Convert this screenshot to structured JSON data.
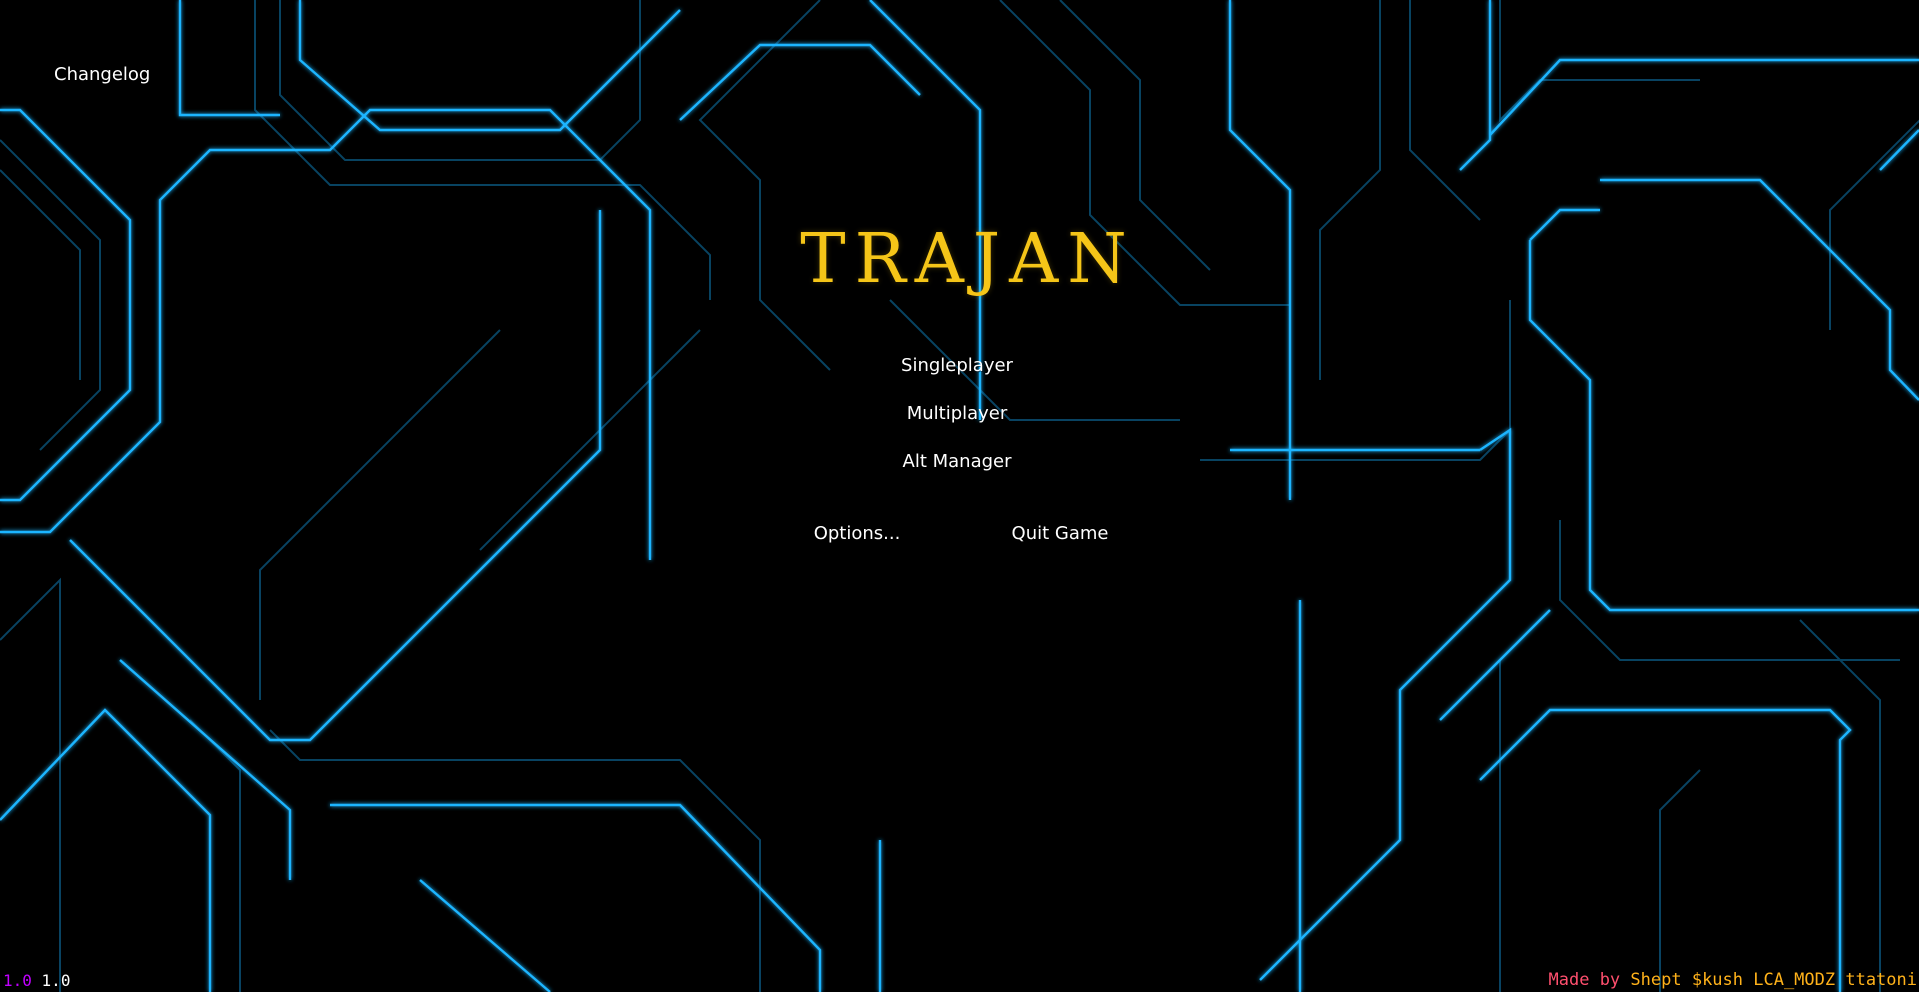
{
  "title": {
    "text": "TRAJAN",
    "color": "#f5c518"
  },
  "changelog": {
    "label": "Changelog"
  },
  "menu": {
    "singleplayer_label": "Singleplayer",
    "multiplayer_label": "Multiplayer",
    "alt_manager_label": "Alt Manager",
    "options_label": "Options...",
    "quit_label": "Quit Game"
  },
  "version": {
    "first": "1.0",
    "second": "1.0",
    "first_color": "#c000ff",
    "second_color": "#ffffff"
  },
  "credits": {
    "prefix": "Made by",
    "names": "Shept $kush LCA_MODZ ttatoni",
    "prefix_color": "#ff4f6e",
    "names_color": "#ffb21a"
  },
  "background": {
    "line_color": "#1fb5ff",
    "dim_line_color": "#0a4f73"
  }
}
